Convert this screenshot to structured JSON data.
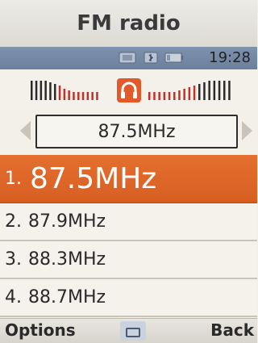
{
  "title": "FM radio",
  "status": {
    "time": "19:28"
  },
  "tuner": {
    "current_frequency": "87.5MHz"
  },
  "presets": [
    {
      "number": "1.",
      "frequency": "87.5MHz",
      "selected": true
    },
    {
      "number": "2.",
      "frequency": "87.9MHz",
      "selected": false
    },
    {
      "number": "3.",
      "frequency": "88.3MHz",
      "selected": false
    },
    {
      "number": "4.",
      "frequency": "88.7MHz",
      "selected": false
    }
  ],
  "softkeys": {
    "left": "Options",
    "right": "Back",
    "center_icon": "radio-icon"
  },
  "colors": {
    "selected": "#e46f2f",
    "status_bar": "#7a8ea9",
    "level_red": "#c4302a",
    "headphone_badge": "#e35a2a"
  }
}
